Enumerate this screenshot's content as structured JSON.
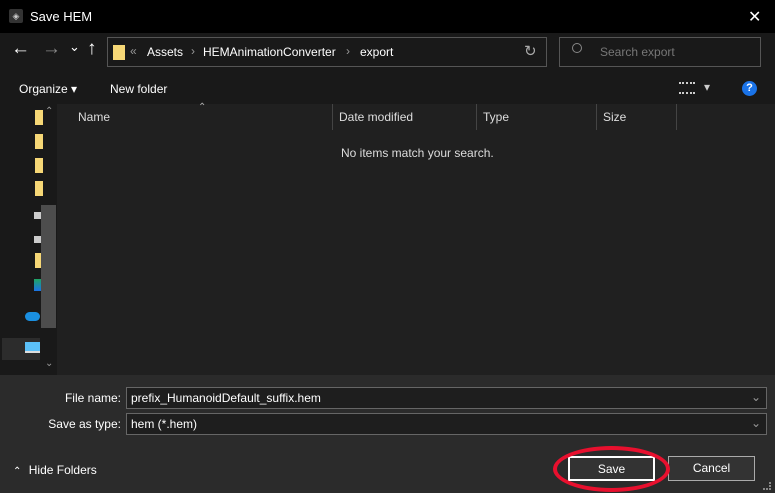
{
  "window": {
    "title": "Save HEM",
    "close": "✕"
  },
  "nav": {
    "back": "←",
    "forward": "→",
    "recent": "⌄",
    "up": "↑",
    "breadcrumb_prefix": "«",
    "breadcrumb": [
      "Assets",
      "HEMAnimationConverter",
      "export"
    ],
    "separator": "›",
    "refresh": "↻",
    "search_placeholder": "Search export"
  },
  "toolbar": {
    "organize": "Organize ▾",
    "new_folder": "New folder",
    "view_dropdown": "▾",
    "help": "?"
  },
  "columns": [
    "Name",
    "Date modified",
    "Type",
    "Size"
  ],
  "empty_message": "No items match your search.",
  "form": {
    "file_name_label": "File name:",
    "file_name_value": "prefix_HumanoidDefault_suffix.hem",
    "save_type_label": "Save as type:",
    "save_type_value": "hem (*.hem)"
  },
  "footer": {
    "hide_folders": "Hide Folders",
    "save": "Save",
    "cancel": "Cancel"
  },
  "colors": {
    "highlight": "#e8102e",
    "folder": "#f6d776",
    "help": "#1a73e8"
  }
}
